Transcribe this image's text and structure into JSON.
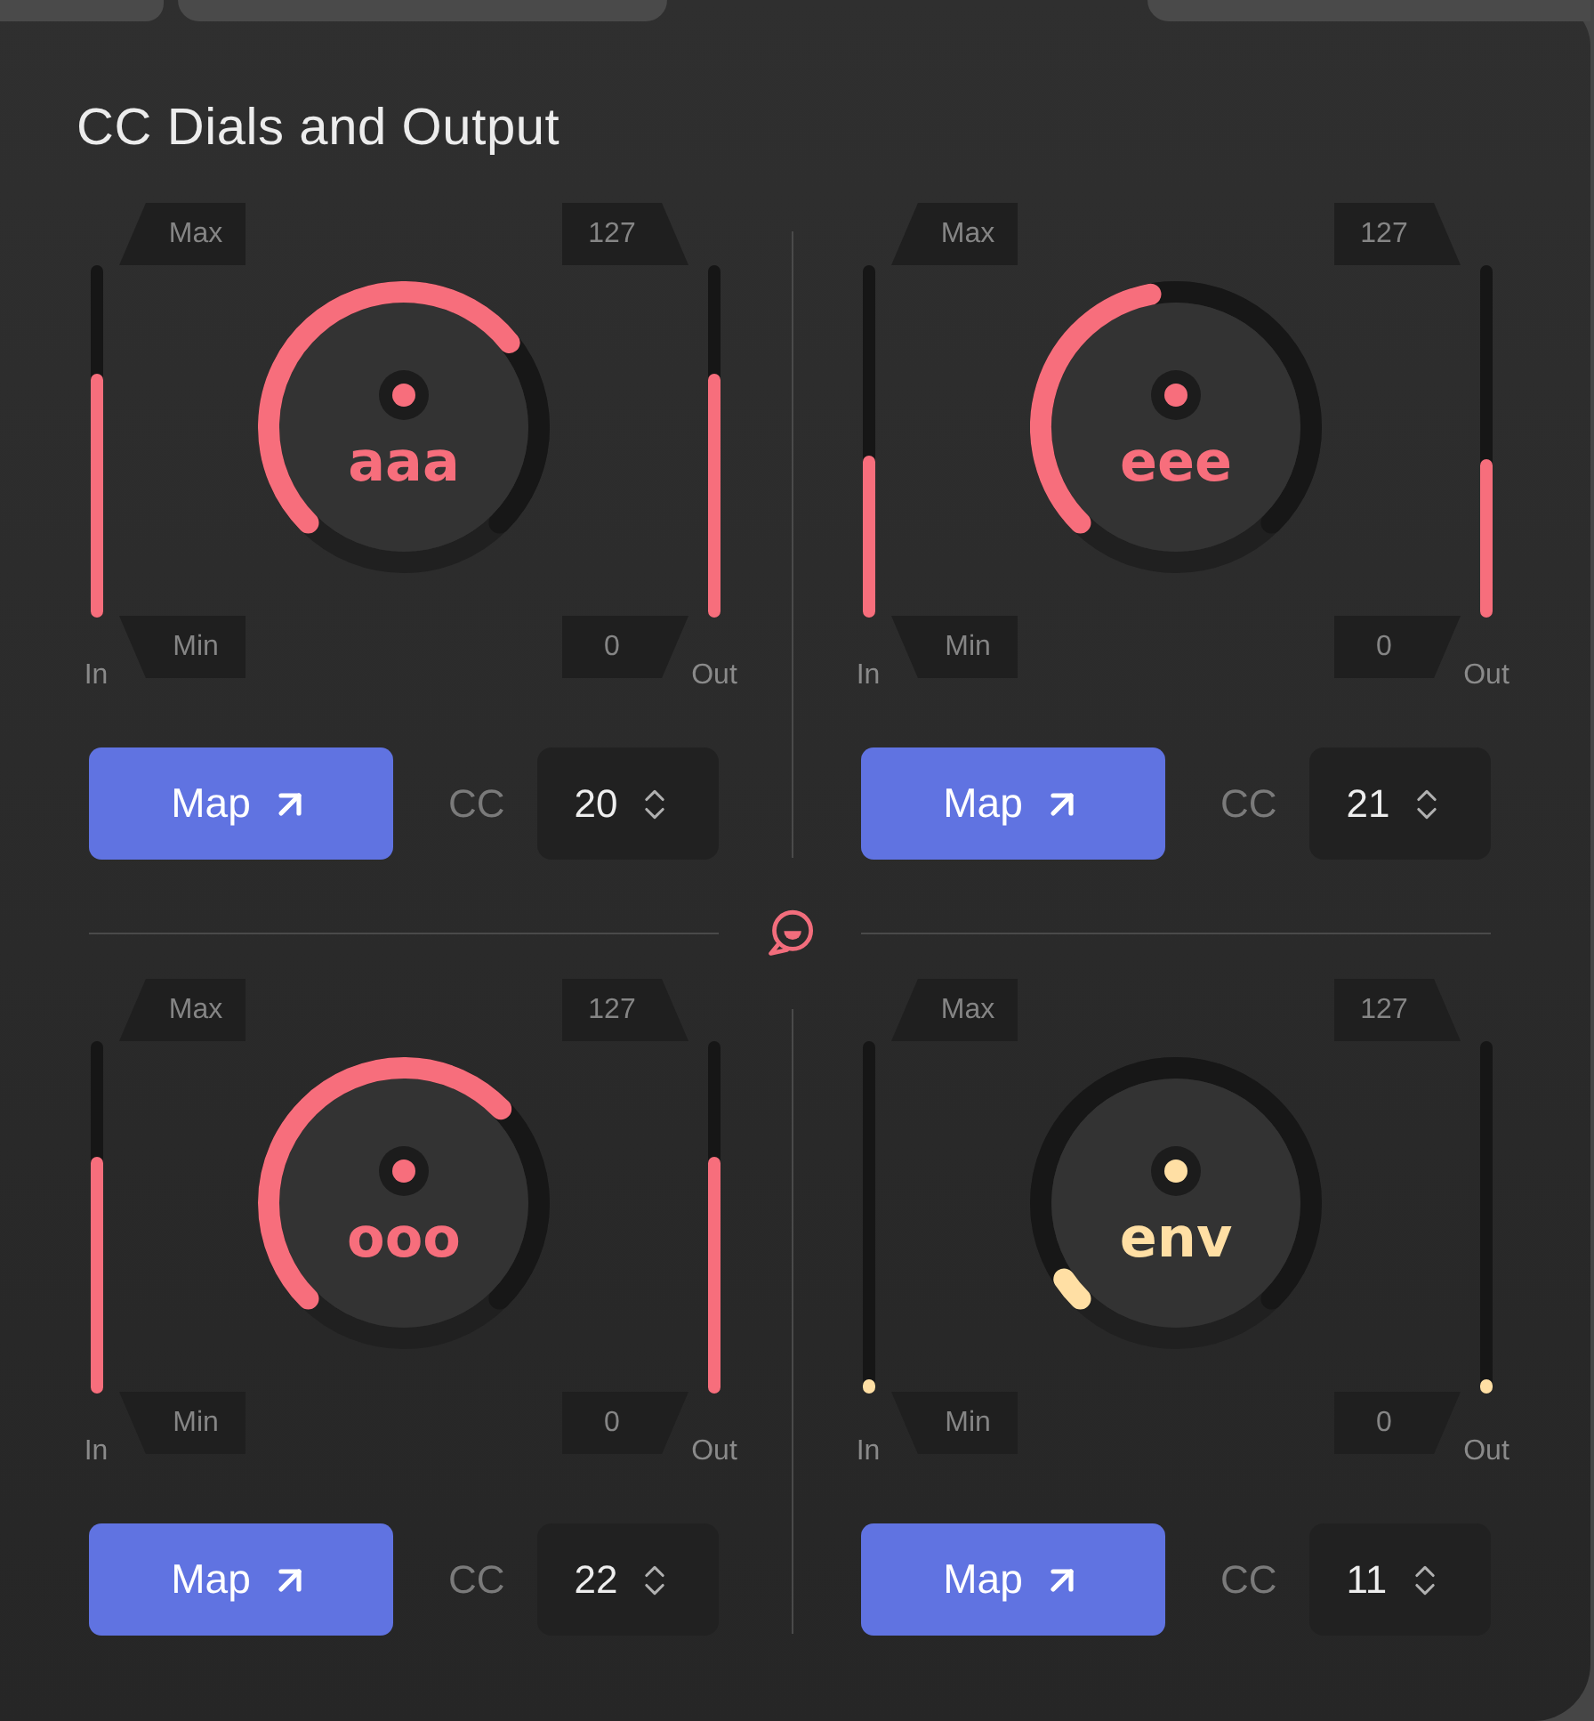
{
  "title": "CC Dials and Output",
  "dials": [
    {
      "label": "aaa",
      "color": "#f76e7c",
      "input": {
        "max": "Max",
        "min": "Min",
        "caption": "In",
        "level": 0.69
      },
      "output": {
        "max": "127",
        "min": "0",
        "caption": "Out",
        "level": 0.69
      },
      "button": "Map",
      "cc_label": "CC",
      "cc_value": "20"
    },
    {
      "label": "eee",
      "color": "#f76e7c",
      "input": {
        "max": "Max",
        "min": "Min",
        "caption": "In",
        "level": 0.46
      },
      "output": {
        "max": "127",
        "min": "0",
        "caption": "Out",
        "level": 0.45
      },
      "button": "Map",
      "cc_label": "CC",
      "cc_value": "21"
    },
    {
      "label": "ooo",
      "color": "#f76e7c",
      "input": {
        "max": "Max",
        "min": "Min",
        "caption": "In",
        "level": 0.67
      },
      "output": {
        "max": "127",
        "min": "0",
        "caption": "Out",
        "level": 0.67
      },
      "button": "Map",
      "cc_label": "CC",
      "cc_value": "22"
    },
    {
      "label": "env",
      "color": "#ffdfa4",
      "input": {
        "max": "Max",
        "min": "Min",
        "caption": "In",
        "level": 0.04
      },
      "output": {
        "max": "127",
        "min": "0",
        "caption": "Out",
        "level": 0.04
      },
      "button": "Map",
      "cc_label": "CC",
      "cc_value": "11"
    }
  ]
}
